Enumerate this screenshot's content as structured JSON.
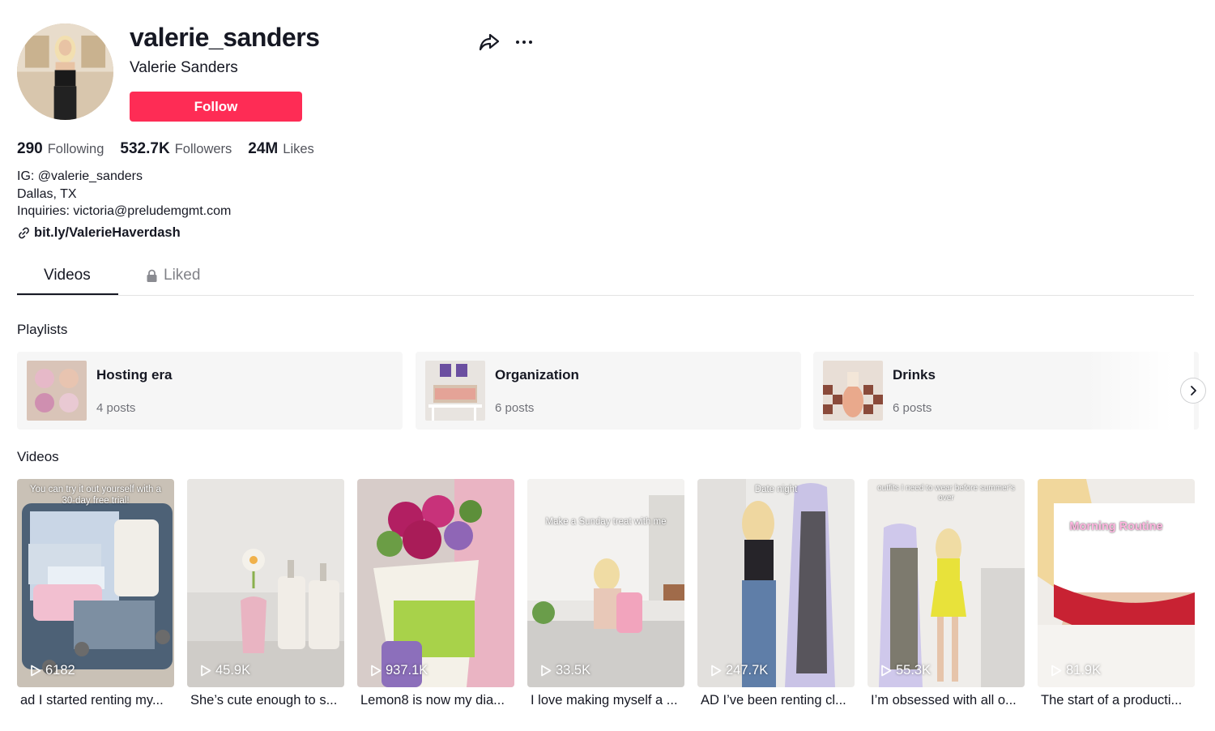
{
  "profile": {
    "username": "valerie_sanders",
    "nickname": "Valerie Sanders",
    "follow_label": "Follow"
  },
  "stats": {
    "following_count": "290",
    "following_label": "Following",
    "followers_count": "532.7K",
    "followers_label": "Followers",
    "likes_count": "24M",
    "likes_label": "Likes"
  },
  "bio": {
    "line1": "IG: @valerie_sanders",
    "line2": "Dallas, TX",
    "line3": "Inquiries: victoria@preludemgmt.com",
    "link": "bit.ly/ValerieHaverdash"
  },
  "tabs": {
    "videos": "Videos",
    "liked": "Liked"
  },
  "sections": {
    "playlists_title": "Playlists",
    "videos_title": "Videos"
  },
  "playlists": [
    {
      "title": "Hosting era",
      "count": "4 posts"
    },
    {
      "title": "Organization",
      "count": "6 posts"
    },
    {
      "title": "Drinks",
      "count": "6 posts"
    }
  ],
  "videos": [
    {
      "views": "6182",
      "caption": "ad I started renting my...",
      "overlay": "You can try it out yourself with a 30-day free trial!"
    },
    {
      "views": "45.9K",
      "caption": "She’s cute enough to s...",
      "overlay": ""
    },
    {
      "views": "937.1K",
      "caption": "Lemon8 is now my dia...",
      "overlay": ""
    },
    {
      "views": "33.5K",
      "caption": "I love making myself a ...",
      "overlay": "Make a Sunday treat with me"
    },
    {
      "views": "247.7K",
      "caption": "AD I’ve been renting cl...",
      "overlay": "Date night"
    },
    {
      "views": "55.3K",
      "caption": "I’m obsessed with all o...",
      "overlay": "outfits I need to wear before summer's over"
    },
    {
      "views": "81.9K",
      "caption": "The start of a producti...",
      "overlay": "Morning Routine"
    }
  ],
  "colors": {
    "follow_button": "#fe2c55",
    "text_primary": "#161823",
    "playlist_bg": "#f6f6f6"
  },
  "icons": {
    "share": "share-arrow-icon",
    "more": "more-dots-icon",
    "link": "link-icon",
    "lock": "lock-icon",
    "play": "play-icon",
    "next": "chevron-right-icon"
  }
}
